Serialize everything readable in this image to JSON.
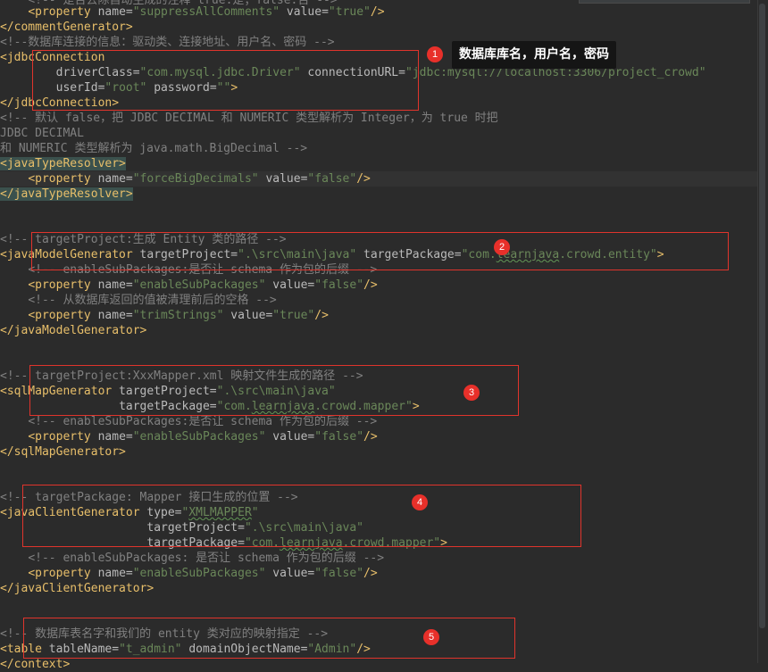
{
  "lines": {
    "l0": {
      "indent": "    ",
      "comment": "<!-- 是否去除自动生成的注释 true:是；false:否 -->"
    },
    "l1": {
      "indent": "    ",
      "open": "<property",
      "n1": " name=",
      "v1": "\"suppressAllComments\"",
      "n2": " value=",
      "v2": "\"true\"",
      "close": "/>"
    },
    "l2": {
      "indent": "",
      "tag": "</commentGenerator>"
    },
    "l3": {
      "indent": "",
      "comment": "<!--数据库连接的信息：驱动类、连接地址、用户名、密码 -->"
    },
    "l4": {
      "indent": "",
      "tag": "<jdbcConnection"
    },
    "l5": {
      "indent": "        ",
      "n1": "driverClass=",
      "v1": "\"com.mysql.jdbc.Driver\"",
      "n2": " connectionURL=",
      "v2": "\"jdbc:mysql://localhost:3306/project_crowd\""
    },
    "l6": {
      "indent": "        ",
      "n1": "userId=",
      "v1": "\"root\"",
      "n2": " password=",
      "v2": "\"\"",
      "close": ">"
    },
    "l7": {
      "indent": "",
      "tag": "</jdbcConnection>"
    },
    "l8": {
      "indent": "",
      "comment": "<!-- 默认 false，把 JDBC DECIMAL 和 NUMERIC 类型解析为 Integer，为 true 时把"
    },
    "l9": {
      "indent": "",
      "comment": "JDBC DECIMAL"
    },
    "l10": {
      "indent": "",
      "comment": "和 NUMERIC 类型解析为 java.math.BigDecimal -->"
    },
    "l11": {
      "indent": "",
      "tag": "<javaTypeResolver>"
    },
    "l12": {
      "indent": "    ",
      "open": "<property",
      "n1": " name=",
      "v1": "\"forceBigDecimals\"",
      "n2": " value=",
      "v2": "\"false\"",
      "close": "/>"
    },
    "l13": {
      "indent": "",
      "tag": "</javaTypeResolver>"
    },
    "l14": {
      "indent": "",
      "comment": "<!-- targetProject:生成 Entity 类的路径 -->"
    },
    "l15": {
      "indent": "",
      "open": "<javaModelGenerator",
      "n1": " targetProject=",
      "v1": "\".\\src\\main\\java\"",
      "n2": " targetPackage=",
      "v2a": "\"com.",
      "v2b": "learnjava",
      "v2c": ".crowd.entity\"",
      "close": ">"
    },
    "l16": {
      "indent": "    ",
      "comment": "<!-- enableSubPackages:是否让 schema 作为包的后缀 -->"
    },
    "l17": {
      "indent": "    ",
      "open": "<property",
      "n1": " name=",
      "v1": "\"enableSubPackages\"",
      "n2": " value=",
      "v2": "\"false\"",
      "close": "/>"
    },
    "l18": {
      "indent": "    ",
      "comment": "<!-- 从数据库返回的值被清理前后的空格 -->"
    },
    "l19": {
      "indent": "    ",
      "open": "<property",
      "n1": " name=",
      "v1": "\"trimStrings\"",
      "n2": " value=",
      "v2": "\"true\"",
      "close": "/>"
    },
    "l20": {
      "indent": "",
      "tag": "</javaModelGenerator>"
    },
    "l21": {
      "indent": "",
      "comment": "<!-- targetProject:XxxMapper.xml 映射文件生成的路径 -->"
    },
    "l22": {
      "indent": "",
      "open": "<sqlMapGenerator",
      "n1": " targetProject=",
      "v1": "\".\\src\\main\\java\""
    },
    "l23": {
      "indent": "                 ",
      "n1": "targetPackage=",
      "v2a": "\"com.",
      "v2b": "learnjava",
      "v2c": ".crowd.mapper\"",
      "close": ">"
    },
    "l24": {
      "indent": "    ",
      "comment": "<!-- enableSubPackages:是否让 schema 作为包的后缀 -->"
    },
    "l25": {
      "indent": "    ",
      "open": "<property",
      "n1": " name=",
      "v1": "\"enableSubPackages\"",
      "n2": " value=",
      "v2": "\"false\"",
      "close": "/>"
    },
    "l26": {
      "indent": "",
      "tag": "</sqlMapGenerator>"
    },
    "l27": {
      "indent": "",
      "comment": "<!-- targetPackage: Mapper 接口生成的位置 -->"
    },
    "l28": {
      "indent": "",
      "open": "<javaClientGenerator",
      "n1": " type=",
      "v2a": "\"",
      "v2b": "XMLMAPPER",
      "v2c": "\""
    },
    "l29": {
      "indent": "                     ",
      "n1": "targetProject=",
      "v1": "\".\\src\\main\\java\""
    },
    "l30": {
      "indent": "                     ",
      "n1": "targetPackage=",
      "v2a": "\"com.",
      "v2b": "learnjava",
      "v2c": ".crowd.mapper\"",
      "close": ">"
    },
    "l31": {
      "indent": "    ",
      "comment": "<!-- enableSubPackages: 是否让 schema 作为包的后缀 -->"
    },
    "l32": {
      "indent": "    ",
      "open": "<property",
      "n1": " name=",
      "v1": "\"enableSubPackages\"",
      "n2": " value=",
      "v2": "\"false\"",
      "close": "/>"
    },
    "l33": {
      "indent": "",
      "tag": "</javaClientGenerator>"
    },
    "l34": {
      "indent": "",
      "comment": "<!-- 数据库表名字和我们的 entity 类对应的映射指定 -->"
    },
    "l35": {
      "indent": "",
      "open": "<table",
      "n1": " tableName=",
      "v1": "\"t_admin\"",
      "n2": " domainObjectName=",
      "v2": "\"Admin\"",
      "close": "/>"
    },
    "l36": {
      "indent": "",
      "tag": "</context>"
    }
  },
  "annotations": {
    "badge1": "1",
    "badge2": "2",
    "badge3": "3",
    "badge4": "4",
    "badge5": "5",
    "tooltip1": "数据库库名，用户名，密码"
  },
  "colors": {
    "background": "#2b2b2b",
    "tag": "#e8bf6a",
    "value": "#6a8759",
    "comment": "#808080",
    "annotation": "#e0342c"
  }
}
